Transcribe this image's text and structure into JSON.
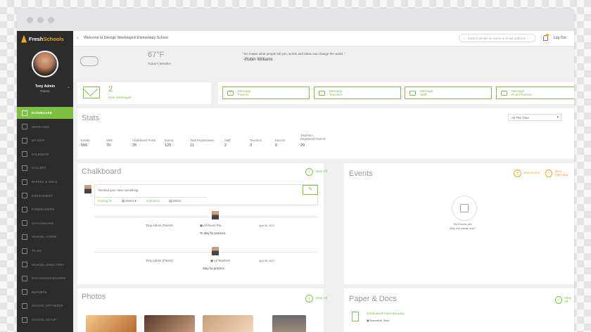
{
  "brand": {
    "name_a": "Fresh",
    "name_b": "Schools"
  },
  "user": {
    "name": "Tony Admin",
    "role": "Parent"
  },
  "nav": [
    {
      "label": "Dashboard",
      "icon": "dashboard-icon",
      "active": true
    },
    {
      "label": "Messages",
      "icon": "envelope-icon"
    },
    {
      "label": "My Kids",
      "icon": "kids-icon"
    },
    {
      "label": "Calendar",
      "icon": "calendar-icon"
    },
    {
      "label": "Gallery",
      "icon": "gallery-icon"
    },
    {
      "label": "Papers & Docs",
      "icon": "docs-icon"
    },
    {
      "label": "Enrichment",
      "icon": "grid-icon"
    },
    {
      "label": "Fundraisers",
      "icon": "trend-icon"
    },
    {
      "label": "Chalkboard",
      "icon": "pencil-icon"
    },
    {
      "label": "School Store",
      "icon": "store-icon"
    },
    {
      "label": "To Do",
      "icon": "todo-icon"
    },
    {
      "label": "School Directory",
      "icon": "directory-icon"
    },
    {
      "label": "Discussion Boards",
      "icon": "chat-icon"
    },
    {
      "label": "Reports",
      "icon": "reports-icon"
    },
    {
      "label": "School Optimizer",
      "icon": "optimizer-icon"
    },
    {
      "label": "School Setup",
      "icon": "setup-icon"
    }
  ],
  "topbar": {
    "welcome": "Welcome to George Washington Elementary School",
    "search_placeholder": "Search people by name or email address",
    "logout": "Log Out"
  },
  "weather": {
    "temp": "67°F",
    "label": "Today's Weather"
  },
  "quote": {
    "text": "\" No matter what people tell you, words and ideas can change the world. \"",
    "author": "-Robin Williams"
  },
  "messages": {
    "count": "2",
    "label": "New Messages"
  },
  "message_buttons": [
    {
      "line1": "Message",
      "line2": "Parents"
    },
    {
      "line1": "Message",
      "line2": "Teachers"
    },
    {
      "line1": "Message",
      "line2": "Staff"
    },
    {
      "line1": "Message",
      "line2": "Room Parents"
    }
  ],
  "stats": {
    "title": "Stats",
    "range": "All The Time",
    "items": [
      {
        "label": "Emails",
        "value": "566"
      },
      {
        "label": "SMS",
        "value": "70"
      },
      {
        "label": "Chalkboard Posts",
        "value": "25"
      },
      {
        "label": "Events",
        "value": "120"
      },
      {
        "label": "Total Registrations",
        "value": "11"
      },
      {
        "label": "Staff",
        "value": "2"
      },
      {
        "label": "Teachers",
        "value": "3"
      },
      {
        "label": "Parents",
        "value": "6"
      },
      {
        "label": "Total Non\nRegistered Parents",
        "value": "29"
      }
    ]
  },
  "chalkboard": {
    "title": "Chalkboard",
    "view_all": "View All",
    "placeholder": "Remind your class something",
    "posting_for": "Posting for",
    "select1": "Select",
    "expiration": "Expiration",
    "select2": "Select",
    "posts": [
      {
        "author": "Tony Admin (Parent)",
        "to": "All Room Par...",
        "date": "April 06, 2017",
        "body": "To stay for practice."
      },
      {
        "author": "Tony Admin (Parent)",
        "to": "All Teachers",
        "date": "April 06, 2017",
        "body": "Stay for practice"
      }
    ]
  },
  "events": {
    "title": "Events",
    "new_event": "New Event",
    "view_calendar": "View Calendar",
    "empty1": "No Events yet.",
    "empty2": "Why not create one?"
  },
  "photos": {
    "title": "Photos",
    "view_all": "View All"
  },
  "papers": {
    "title": "Paper & Docs",
    "view_all": "View All",
    "file": "DedicatedPostsView.png",
    "team": "Basketball Team"
  },
  "colors": {
    "accent": "#7cc142",
    "orange": "#f2a71b",
    "sidebar": "#2c2c2c"
  }
}
